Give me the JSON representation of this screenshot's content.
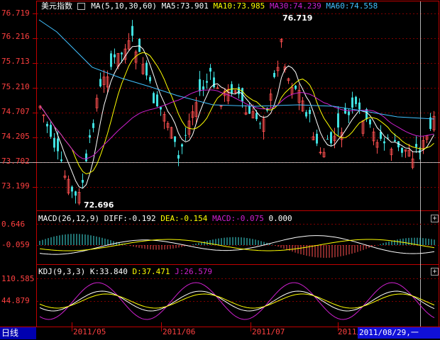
{
  "main_panel": {
    "index_name": "美元指数",
    "ma_label": "MA(5,10,30,60)",
    "ma5": "MA5:73.901",
    "ma10": "MA10:73.985",
    "ma30": "MA30:74.239",
    "ma60": "MA60:74.558",
    "y_ticks": [
      "76.719",
      "76.216",
      "75.713",
      "75.210",
      "74.707",
      "74.205",
      "73.702",
      "73.199"
    ],
    "high_annotation": "76.719",
    "low_annotation": "72.696"
  },
  "macd_panel": {
    "label": "MACD(26,12,9)",
    "diff": "DIFF:-0.192",
    "dea": "DEA:-0.154",
    "macd": "MACD:-0.075",
    "extra": "0.000",
    "y_ticks": [
      "0.646",
      "-0.059"
    ]
  },
  "kdj_panel": {
    "label": "KDJ(9,3,3)",
    "k": "K:33.840",
    "d": "D:37.471",
    "j": "J:26.579",
    "y_ticks": [
      "110.585",
      "44.879"
    ]
  },
  "bottom_bar": {
    "period_tab": "日线",
    "x_labels": [
      "2011/05",
      "2011/06",
      "2011/07",
      "2011/"
    ],
    "cursor_date": "2011/08/29,一"
  },
  "colors": {
    "up": "#ff5050",
    "down": "#40e0e0",
    "ma5": "#ffffff",
    "ma10": "#ffff00",
    "ma30": "#d020d0",
    "ma60": "#40c0ff",
    "grid": "#800000",
    "axis": "#c00000"
  },
  "icons": {
    "index_icon": "candlestick-icon",
    "expand_icon": "plus-icon"
  }
}
